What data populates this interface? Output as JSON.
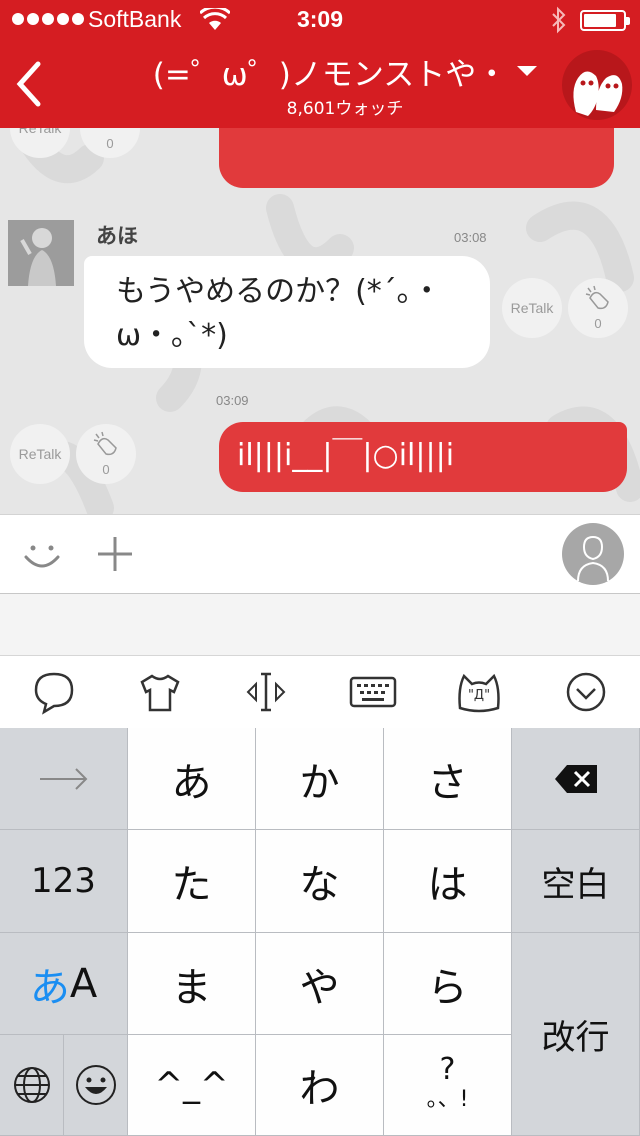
{
  "status_bar": {
    "carrier": "SoftBank",
    "time": "3:09",
    "battery_level": 0.85
  },
  "header": {
    "title": "(=゜ω゜)ノモンストや・",
    "watch_count": "8,601ウォッチ",
    "back_icon": "chevron-left-icon",
    "dropdown_icon": "caret-down-icon",
    "avatar_icon": "ghost-mascot-icon",
    "background_color": "#d51d22"
  },
  "chat": {
    "messages": [
      {
        "type": "outgoing",
        "text": "",
        "retalk_label": "ReTalk",
        "clap_count": "0"
      },
      {
        "type": "incoming",
        "sender": "あほ",
        "time": "03:08",
        "text_line1": "もうやめるのか？(*´｡・",
        "text_line2": "ω・｡`*)",
        "retalk_label": "ReTalk",
        "clap_count": "0"
      },
      {
        "type": "outgoing",
        "time": "03:09",
        "text": "il|||i__|￣|○il|||i",
        "retalk_label": "ReTalk",
        "clap_count": "0"
      }
    ],
    "bubble_red": "#e13a3c"
  },
  "input_bar": {
    "emoji_icon": "smiley-icon",
    "add_icon": "plus-icon",
    "stamp_icon": "user-avatar-icon"
  },
  "keyboard_toolbar": {
    "icons": [
      "speech-bubble-icon",
      "tshirt-icon",
      "cursor-icon",
      "keyboard-icon",
      "cat-face-icon",
      "chevron-down-circle-icon"
    ],
    "cat_face_text": "\"Д\""
  },
  "keyboard": {
    "row1": {
      "left": "→",
      "keys": [
        "あ",
        "か",
        "さ"
      ],
      "right_icon": "backspace-icon"
    },
    "row2": {
      "left": "123",
      "keys": [
        "た",
        "な",
        "は"
      ],
      "right": "空白"
    },
    "row3": {
      "left_a": "あ",
      "left_b": "A",
      "keys": [
        "ま",
        "や",
        "ら"
      ],
      "right": "改行"
    },
    "row4": {
      "globe_icon": "globe-icon",
      "emoji_icon": "emoji-icon",
      "keys": [
        "^_^",
        "わ",
        "?"
      ],
      "punct_sub": "。、!"
    }
  }
}
